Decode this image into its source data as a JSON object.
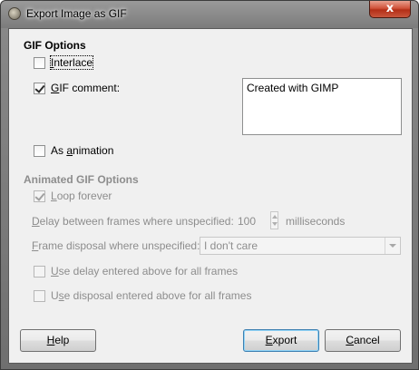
{
  "window": {
    "title": "Export Image as GIF",
    "close_symbol": "x"
  },
  "gif_options": {
    "title": "GIF Options",
    "interlace": {
      "label_mnemonic": "I",
      "label_rest": "nterlace",
      "checked": false
    },
    "gif_comment": {
      "label_mnemonic": "G",
      "label_rest": "IF comment:",
      "checked": true,
      "value": "Created with GIMP"
    },
    "as_animation": {
      "label_pre": "As ",
      "label_mnemonic": "a",
      "label_rest": "nimation",
      "checked": false
    }
  },
  "animated_options": {
    "title": "Animated GIF Options",
    "loop_forever": {
      "label_mnemonic": "L",
      "label_rest": "oop forever",
      "checked": true
    },
    "delay": {
      "label_mnemonic": "D",
      "label_rest": "elay between frames where unspecified:",
      "value": "100",
      "unit": "milliseconds"
    },
    "disposal": {
      "label_mnemonic": "F",
      "label_rest": "rame disposal where unspecified:",
      "selected": "I don't care"
    },
    "use_delay": {
      "label_mnemonic": "U",
      "label_rest": "se delay entered above for all frames",
      "checked": false
    },
    "use_disposal": {
      "label_pre": "U",
      "label_mnemonic": "s",
      "label_rest": "e disposal entered above for all frames",
      "checked": false
    }
  },
  "buttons": {
    "help": {
      "mnemonic": "H",
      "rest": "elp"
    },
    "export": {
      "mnemonic": "E",
      "rest": "xport"
    },
    "cancel": {
      "mnemonic": "C",
      "rest": "ancel"
    }
  }
}
